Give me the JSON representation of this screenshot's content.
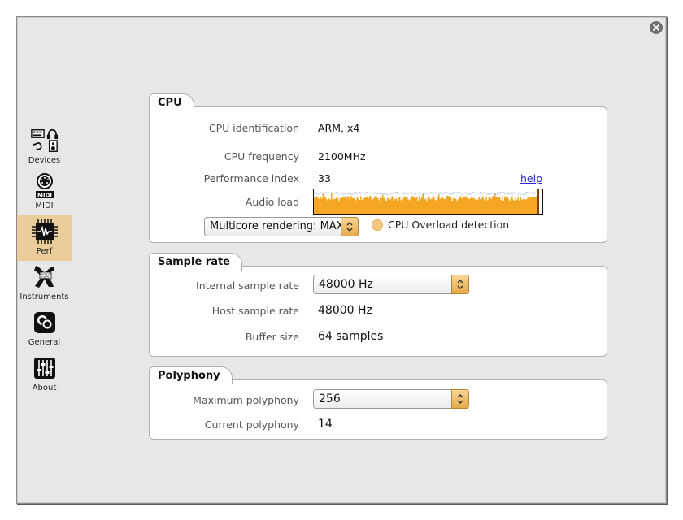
{
  "window": {
    "close_icon": "close-circle-icon"
  },
  "sidebar": {
    "items": [
      {
        "label": "Devices",
        "icon": "devices-icon"
      },
      {
        "label": "MIDI",
        "icon": "midi-icon"
      },
      {
        "label": "Perf",
        "icon": "cpu-chip-icon",
        "active": true
      },
      {
        "label": "Instruments",
        "icon": "instruments-icon"
      },
      {
        "label": "General",
        "icon": "general-icon"
      },
      {
        "label": "About",
        "icon": "sliders-icon"
      }
    ],
    "active_bg": "#ebcd9b"
  },
  "cpu": {
    "title": "CPU",
    "identification_label": "CPU identification",
    "identification_value": "ARM, x4",
    "frequency_label": "CPU frequency",
    "frequency_value": "2100MHz",
    "perf_index_label": "Performance index",
    "perf_index_value": "33",
    "help_link": "help",
    "audio_load_label": "Audio load",
    "audio_load_color": "#f5a623",
    "multicore_select": "Multicore rendering: MAX",
    "overload_label": "CPU Overload detection",
    "overload_led_color": "#f3c77f"
  },
  "sample_rate": {
    "title": "Sample rate",
    "internal_label": "Internal sample rate",
    "internal_value": "48000 Hz",
    "host_label": "Host sample rate",
    "host_value": "48000 Hz",
    "buffer_label": "Buffer size",
    "buffer_value": "64 samples"
  },
  "polyphony": {
    "title": "Polyphony",
    "max_label": "Maximum polyphony",
    "max_value": "256",
    "current_label": "Current polyphony",
    "current_value": "14"
  }
}
